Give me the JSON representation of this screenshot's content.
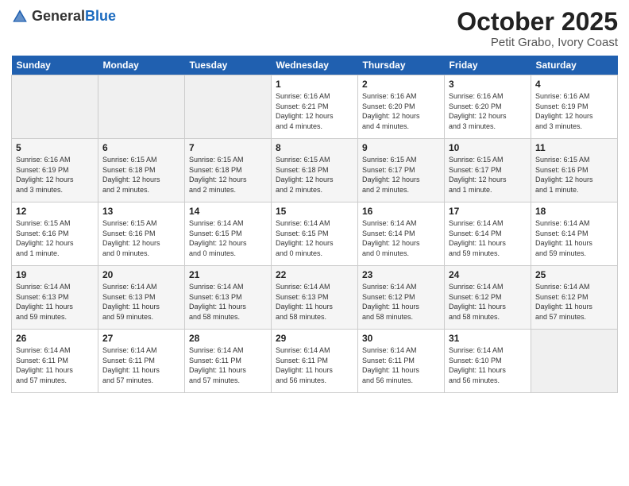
{
  "header": {
    "logo_general": "General",
    "logo_blue": "Blue",
    "month_title": "October 2025",
    "location": "Petit Grabo, Ivory Coast"
  },
  "days_of_week": [
    "Sunday",
    "Monday",
    "Tuesday",
    "Wednesday",
    "Thursday",
    "Friday",
    "Saturday"
  ],
  "weeks": [
    [
      {
        "day": "",
        "info": ""
      },
      {
        "day": "",
        "info": ""
      },
      {
        "day": "",
        "info": ""
      },
      {
        "day": "1",
        "info": "Sunrise: 6:16 AM\nSunset: 6:21 PM\nDaylight: 12 hours\nand 4 minutes."
      },
      {
        "day": "2",
        "info": "Sunrise: 6:16 AM\nSunset: 6:20 PM\nDaylight: 12 hours\nand 4 minutes."
      },
      {
        "day": "3",
        "info": "Sunrise: 6:16 AM\nSunset: 6:20 PM\nDaylight: 12 hours\nand 3 minutes."
      },
      {
        "day": "4",
        "info": "Sunrise: 6:16 AM\nSunset: 6:19 PM\nDaylight: 12 hours\nand 3 minutes."
      }
    ],
    [
      {
        "day": "5",
        "info": "Sunrise: 6:16 AM\nSunset: 6:19 PM\nDaylight: 12 hours\nand 3 minutes."
      },
      {
        "day": "6",
        "info": "Sunrise: 6:15 AM\nSunset: 6:18 PM\nDaylight: 12 hours\nand 2 minutes."
      },
      {
        "day": "7",
        "info": "Sunrise: 6:15 AM\nSunset: 6:18 PM\nDaylight: 12 hours\nand 2 minutes."
      },
      {
        "day": "8",
        "info": "Sunrise: 6:15 AM\nSunset: 6:18 PM\nDaylight: 12 hours\nand 2 minutes."
      },
      {
        "day": "9",
        "info": "Sunrise: 6:15 AM\nSunset: 6:17 PM\nDaylight: 12 hours\nand 2 minutes."
      },
      {
        "day": "10",
        "info": "Sunrise: 6:15 AM\nSunset: 6:17 PM\nDaylight: 12 hours\nand 1 minute."
      },
      {
        "day": "11",
        "info": "Sunrise: 6:15 AM\nSunset: 6:16 PM\nDaylight: 12 hours\nand 1 minute."
      }
    ],
    [
      {
        "day": "12",
        "info": "Sunrise: 6:15 AM\nSunset: 6:16 PM\nDaylight: 12 hours\nand 1 minute."
      },
      {
        "day": "13",
        "info": "Sunrise: 6:15 AM\nSunset: 6:16 PM\nDaylight: 12 hours\nand 0 minutes."
      },
      {
        "day": "14",
        "info": "Sunrise: 6:14 AM\nSunset: 6:15 PM\nDaylight: 12 hours\nand 0 minutes."
      },
      {
        "day": "15",
        "info": "Sunrise: 6:14 AM\nSunset: 6:15 PM\nDaylight: 12 hours\nand 0 minutes."
      },
      {
        "day": "16",
        "info": "Sunrise: 6:14 AM\nSunset: 6:14 PM\nDaylight: 12 hours\nand 0 minutes."
      },
      {
        "day": "17",
        "info": "Sunrise: 6:14 AM\nSunset: 6:14 PM\nDaylight: 11 hours\nand 59 minutes."
      },
      {
        "day": "18",
        "info": "Sunrise: 6:14 AM\nSunset: 6:14 PM\nDaylight: 11 hours\nand 59 minutes."
      }
    ],
    [
      {
        "day": "19",
        "info": "Sunrise: 6:14 AM\nSunset: 6:13 PM\nDaylight: 11 hours\nand 59 minutes."
      },
      {
        "day": "20",
        "info": "Sunrise: 6:14 AM\nSunset: 6:13 PM\nDaylight: 11 hours\nand 59 minutes."
      },
      {
        "day": "21",
        "info": "Sunrise: 6:14 AM\nSunset: 6:13 PM\nDaylight: 11 hours\nand 58 minutes."
      },
      {
        "day": "22",
        "info": "Sunrise: 6:14 AM\nSunset: 6:13 PM\nDaylight: 11 hours\nand 58 minutes."
      },
      {
        "day": "23",
        "info": "Sunrise: 6:14 AM\nSunset: 6:12 PM\nDaylight: 11 hours\nand 58 minutes."
      },
      {
        "day": "24",
        "info": "Sunrise: 6:14 AM\nSunset: 6:12 PM\nDaylight: 11 hours\nand 58 minutes."
      },
      {
        "day": "25",
        "info": "Sunrise: 6:14 AM\nSunset: 6:12 PM\nDaylight: 11 hours\nand 57 minutes."
      }
    ],
    [
      {
        "day": "26",
        "info": "Sunrise: 6:14 AM\nSunset: 6:11 PM\nDaylight: 11 hours\nand 57 minutes."
      },
      {
        "day": "27",
        "info": "Sunrise: 6:14 AM\nSunset: 6:11 PM\nDaylight: 11 hours\nand 57 minutes."
      },
      {
        "day": "28",
        "info": "Sunrise: 6:14 AM\nSunset: 6:11 PM\nDaylight: 11 hours\nand 57 minutes."
      },
      {
        "day": "29",
        "info": "Sunrise: 6:14 AM\nSunset: 6:11 PM\nDaylight: 11 hours\nand 56 minutes."
      },
      {
        "day": "30",
        "info": "Sunrise: 6:14 AM\nSunset: 6:11 PM\nDaylight: 11 hours\nand 56 minutes."
      },
      {
        "day": "31",
        "info": "Sunrise: 6:14 AM\nSunset: 6:10 PM\nDaylight: 11 hours\nand 56 minutes."
      },
      {
        "day": "",
        "info": ""
      }
    ]
  ]
}
